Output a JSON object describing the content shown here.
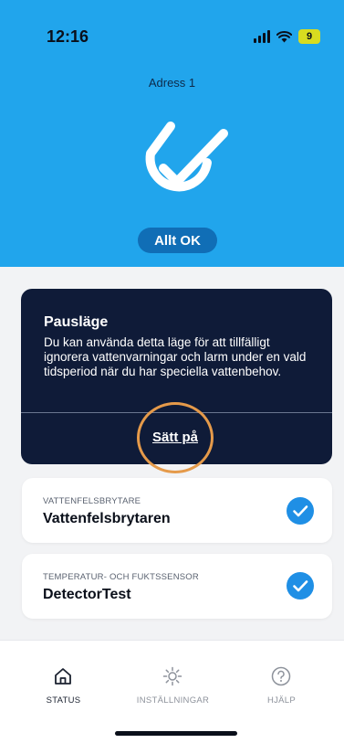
{
  "status_bar": {
    "time": "12:16",
    "battery": "9"
  },
  "header": {
    "address": "Adress 1",
    "status_label": "Allt OK"
  },
  "pause_card": {
    "title": "Pausläge",
    "description": "Du kan använda detta läge för att tillfälligt ignorera vattenvarningar och larm under en vald tidsperiod när du har speciella vattenbehov.",
    "action_label": "Sätt på"
  },
  "sensors": [
    {
      "type": "VATTENFELSBRYTARE",
      "name": "Vattenfelsbrytaren"
    },
    {
      "type": "TEMPERATUR- OCH FUKTSSENSOR",
      "name": "DetectorTest"
    }
  ],
  "nav": {
    "items": [
      {
        "label": "STATUS",
        "icon": "home-icon"
      },
      {
        "label": "INSTÄLLNINGAR",
        "icon": "gear-icon"
      },
      {
        "label": "HJÄLP",
        "icon": "help-icon"
      }
    ],
    "active_index": 0
  },
  "colors": {
    "header_bg": "#21a5ec",
    "pill_bg": "#106eb6",
    "card_dark": "#0f1b38",
    "check_blue": "#1f8fe5",
    "highlight": "#e59a4a"
  }
}
